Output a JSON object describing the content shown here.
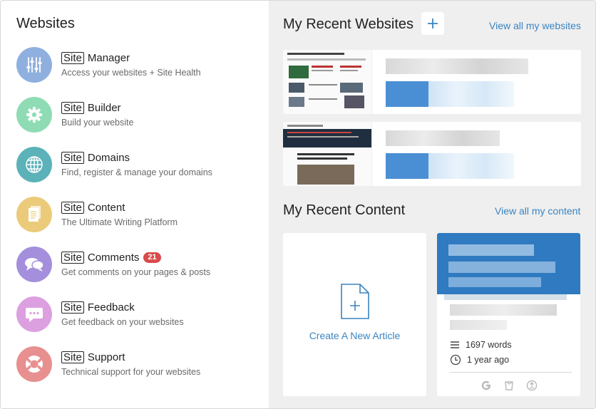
{
  "left_panel": {
    "title": "Websites",
    "items": [
      {
        "key": "manager",
        "prefix": "Site",
        "name": "Manager",
        "subtitle": "Access your websites + Site Health",
        "icon": "sliders-icon",
        "color": "#8fb0df"
      },
      {
        "key": "builder",
        "prefix": "Site",
        "name": "Builder",
        "subtitle": "Build your website",
        "icon": "gear-icon",
        "color": "#8fdcb4"
      },
      {
        "key": "domains",
        "prefix": "Site",
        "name": "Domains",
        "subtitle": "Find, register & manage your domains",
        "icon": "globe-icon",
        "color": "#5bb2b9"
      },
      {
        "key": "content",
        "prefix": "Site",
        "name": "Content",
        "subtitle": "The Ultimate Writing Platform",
        "icon": "documents-icon",
        "color": "#ebcb7a"
      },
      {
        "key": "comments",
        "prefix": "Site",
        "name": "Comments",
        "subtitle": "Get comments on your pages & posts",
        "icon": "chat-bubbles-icon",
        "color": "#a48fdc",
        "badge": "21"
      },
      {
        "key": "feedback",
        "prefix": "Site",
        "name": "Feedback",
        "subtitle": "Get feedback on your websites",
        "icon": "speech-bubble-icon",
        "color": "#dca0e0"
      },
      {
        "key": "support",
        "prefix": "Site",
        "name": "Support",
        "subtitle": "Technical support for your websites",
        "icon": "lifebuoy-icon",
        "color": "#e88f8f"
      }
    ]
  },
  "recent_websites": {
    "title": "My Recent Websites",
    "view_all": "View all my websites",
    "add_icon": "plus-icon"
  },
  "recent_content": {
    "title": "My Recent Content",
    "view_all": "View all my content",
    "create_label": "Create A New Article",
    "article": {
      "words": "1697 words",
      "age": "1 year ago"
    }
  },
  "colors": {
    "accent": "#3a84c1",
    "badge": "#d94a4a",
    "panel_bg": "#efefef"
  }
}
